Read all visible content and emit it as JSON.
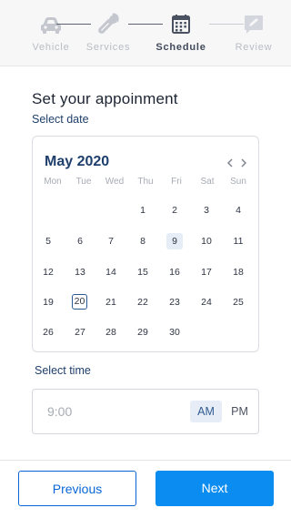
{
  "steps": [
    {
      "label": "Vehicle",
      "icon": "car-icon"
    },
    {
      "label": "Services",
      "icon": "wrench-icon"
    },
    {
      "label": "Schedule",
      "icon": "calendar-icon"
    },
    {
      "label": "Review",
      "icon": "review-icon"
    }
  ],
  "active_step": "Schedule",
  "heading": "Set your appoinment",
  "select_date_label": "Select date",
  "calendar": {
    "month_label": "May 2020",
    "prev_icon": "chevron-left-icon",
    "next_icon": "chevron-right-icon",
    "weekdays": [
      "Mon",
      "Tue",
      "Wed",
      "Thu",
      "Fri",
      "Sat",
      "Sun"
    ],
    "weeks": [
      [
        "",
        "",
        "",
        "1",
        "2",
        "3",
        "4"
      ],
      [
        "5",
        "6",
        "7",
        "8",
        "9",
        "10",
        "11"
      ],
      [
        "12",
        "13",
        "14",
        "15",
        "16",
        "17",
        "18"
      ],
      [
        "19",
        "20",
        "21",
        "22",
        "23",
        "24",
        "25"
      ],
      [
        "26",
        "27",
        "28",
        "29",
        "30",
        "",
        ""
      ]
    ],
    "highlighted_day": "9",
    "today_day": "20"
  },
  "select_time_label": "Select time",
  "time": {
    "value": "9:00",
    "am_label": "AM",
    "pm_label": "PM",
    "selected": "AM"
  },
  "footer": {
    "previous_label": "Previous",
    "next_label": "Next"
  },
  "colors": {
    "primary": "#0a8cf0",
    "primary_outline": "#0a66d6",
    "heading_blue": "#1f3f6c",
    "highlight_bg": "#e7edf6"
  }
}
